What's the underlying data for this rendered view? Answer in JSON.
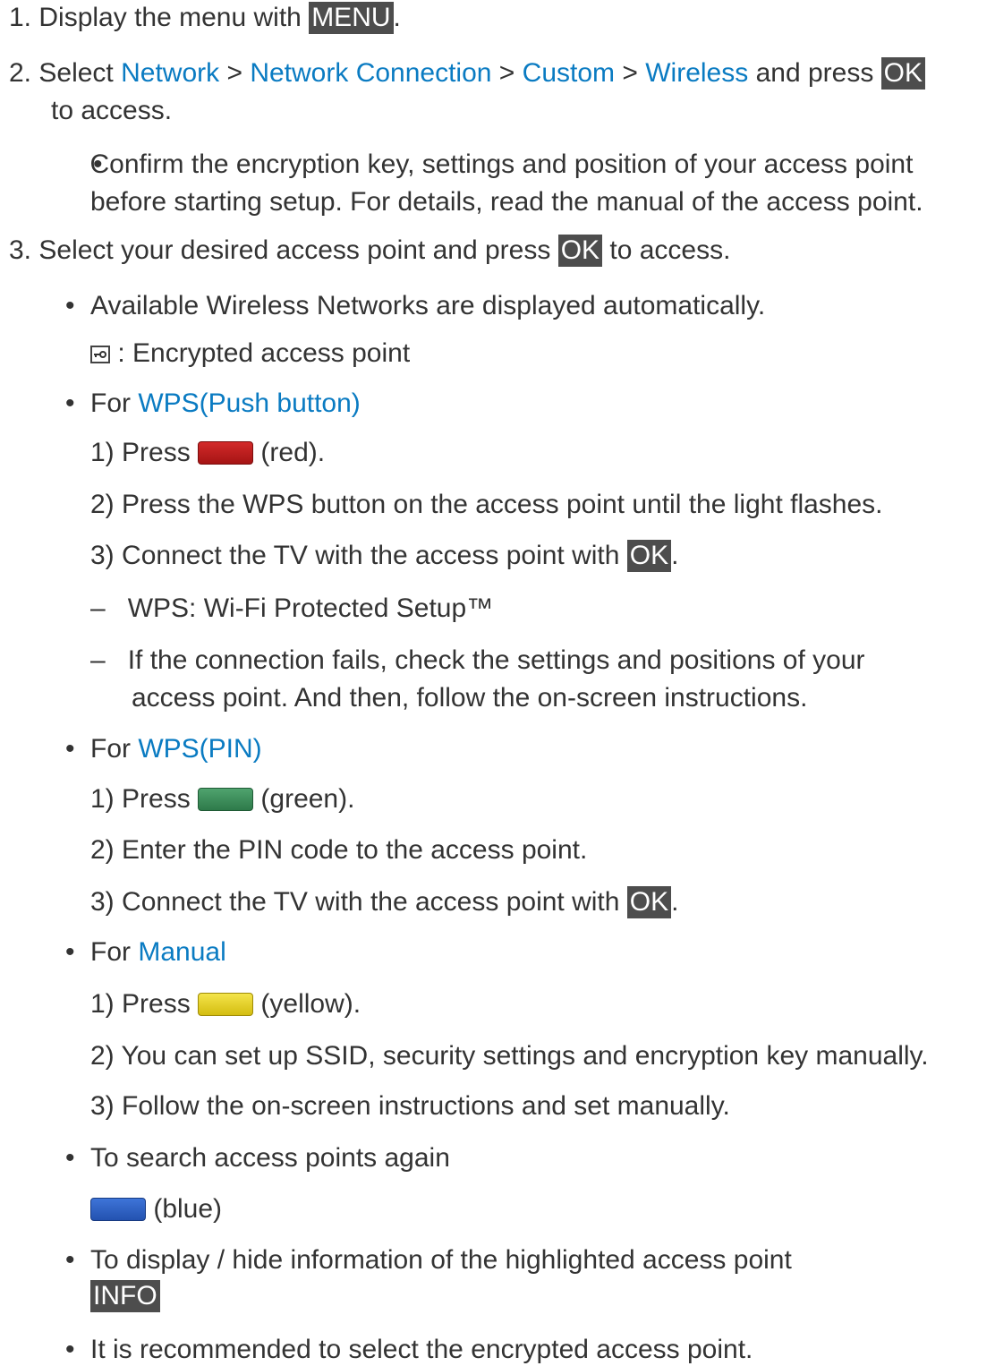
{
  "steps": {
    "s1": {
      "num": "1.",
      "text_a": "Display the menu with ",
      "key": "MENU",
      "text_b": "."
    },
    "s2": {
      "num": "2.",
      "text_a": "Select ",
      "link1": "Network",
      "sep1": " > ",
      "link2": "Network Connection",
      "sep2": " > ",
      "link3": "Custom",
      "sep3": " > ",
      "link4": "Wireless",
      "text_b": " and press ",
      "key": "OK",
      "text_c": "to access.",
      "bullet1_l1": "Confirm the encryption key, settings and position of your access point",
      "bullet1_l2": "before starting setup. For details, read the manual of the access point."
    },
    "s3": {
      "num": "3.",
      "text_a": "Select your desired access point and press ",
      "key": "OK",
      "text_b": " to access.",
      "b_available": "Available Wireless Networks are displayed automatically.",
      "encrypted_label": " : Encrypted access point",
      "wps_push": {
        "prefix": "For ",
        "link": "WPS(Push button)",
        "i1_num": "1)",
        "i1_a": "Press ",
        "i1_b": " (red).",
        "i2_num": "2)",
        "i2": "Press the WPS button on the access point until the light flashes.",
        "i3_num": "3)",
        "i3_a": "Connect the TV with the access point with ",
        "i3_key": "OK",
        "i3_b": ".",
        "d1": "WPS: Wi-Fi Protected Setup™",
        "d2_l1": "If the connection fails, check the settings and positions of your",
        "d2_l2": "access point. And then, follow the on-screen instructions."
      },
      "wps_pin": {
        "prefix": "For ",
        "link": "WPS(PIN)",
        "i1_num": "1)",
        "i1_a": "Press ",
        "i1_b": " (green).",
        "i2_num": "2)",
        "i2": "Enter the PIN code to the access point.",
        "i3_num": "3)",
        "i3_a": "Connect the TV with the access point with ",
        "i3_key": "OK",
        "i3_b": "."
      },
      "manual": {
        "prefix": "For ",
        "link": "Manual",
        "i1_num": "1)",
        "i1_a": "Press ",
        "i1_b": " (yellow).",
        "i2_num": "2)",
        "i2": "You can set up SSID, security settings and encryption key manually.",
        "i3_num": "3)",
        "i3": "Follow the on-screen instructions and set manually."
      },
      "search_again": "To search access points again",
      "blue_label": " (blue)",
      "display_hide": "To display / hide information of the highlighted access point",
      "info_key": "INFO",
      "recommend": "It is recommended to select the encrypted access point."
    }
  },
  "bullet": "•",
  "dash": "–",
  "colors": {
    "link": "#0a7bc2",
    "key_bg": "#4d4d4d",
    "text": "#333333"
  },
  "icons": {
    "encrypted": "encrypted-access-point-icon",
    "red": "red-button-icon",
    "green": "green-button-icon",
    "yellow": "yellow-button-icon",
    "blue": "blue-button-icon"
  }
}
